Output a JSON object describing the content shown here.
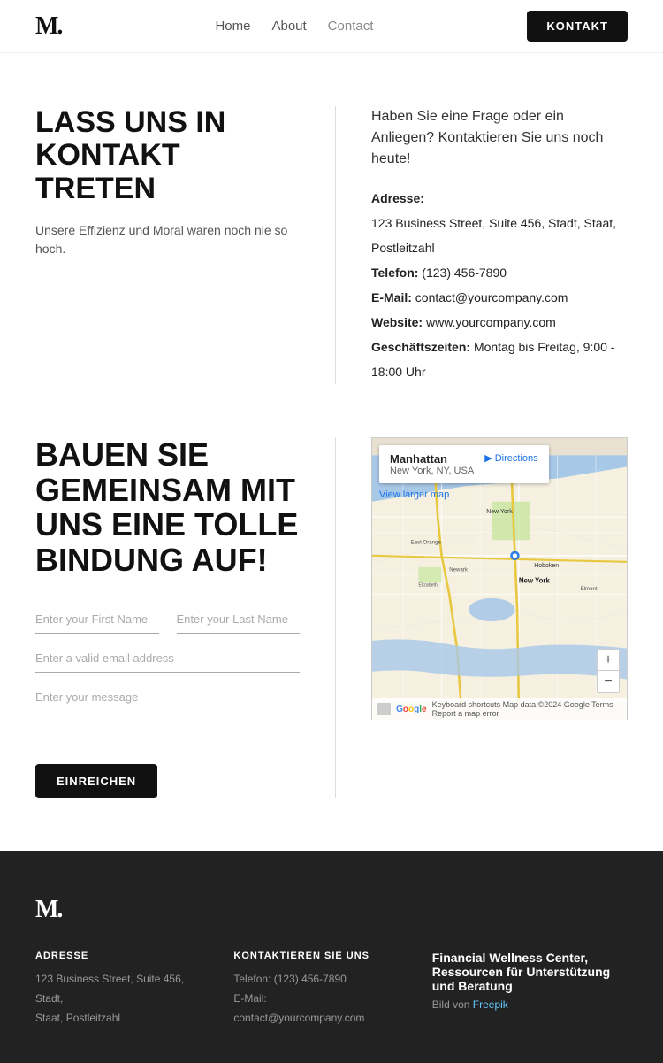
{
  "nav": {
    "logo": "M.",
    "links": [
      {
        "label": "Home",
        "active": false
      },
      {
        "label": "About",
        "active": false
      },
      {
        "label": "Contact",
        "active": true
      }
    ],
    "cta": "KONTAKT"
  },
  "section1": {
    "heading_line1": "LASS UNS IN KONTAKT",
    "heading_line2": "TRETEN",
    "subtext": "Unsere Effizienz und Moral waren noch nie so hoch.",
    "tagline": "Haben Sie eine Frage oder ein Anliegen? Kontaktieren Sie uns noch heute!",
    "address_label": "Adresse:",
    "address_value": "123 Business Street, Suite 456, Stadt, Staat, Postleitzahl",
    "telefon_label": "Telefon:",
    "telefon_value": "(123) 456-7890",
    "email_label": "E-Mail:",
    "email_value": "contact@yourcompany.com",
    "website_label": "Website:",
    "website_value": "www.yourcompany.com",
    "hours_label": "Geschäftszeiten:",
    "hours_value": "Montag bis Freitag, 9:00 - 18:00 Uhr"
  },
  "section2": {
    "heading": "BAUEN SIE GEMEINSAM MIT UNS EINE TOLLE BINDUNG AUF!",
    "form": {
      "first_name_placeholder": "Enter your First Name",
      "last_name_placeholder": "Enter your Last Name",
      "email_placeholder": "Enter a valid email address",
      "message_placeholder": "Enter your message",
      "submit_label": "EINREICHEN"
    },
    "map": {
      "place_name": "Manhattan",
      "place_sub": "New York, NY, USA",
      "directions_label": "Directions",
      "larger_map": "View larger map",
      "plus": "+",
      "minus": "−",
      "footer_text": "Keyboard shortcuts   Map data ©2024 Google   Terms   Report a map error"
    }
  },
  "footer": {
    "logo": "M.",
    "col1_title": "ADRESSE",
    "col1_line1": "123 Business Street, Suite 456, Stadt,",
    "col1_line2": "Staat, Postleitzahl",
    "col2_title": "KONTAKTIEREN SIE UNS",
    "col2_telefon": "Telefon: (123) 456-7890",
    "col2_email": "E-Mail: contact@yourcompany.com",
    "col3_promo": "Financial Wellness Center, Ressourcen für Unterstützung und Beratung",
    "col3_sub_prefix": "Bild von ",
    "col3_sub_link": "Freepik"
  }
}
